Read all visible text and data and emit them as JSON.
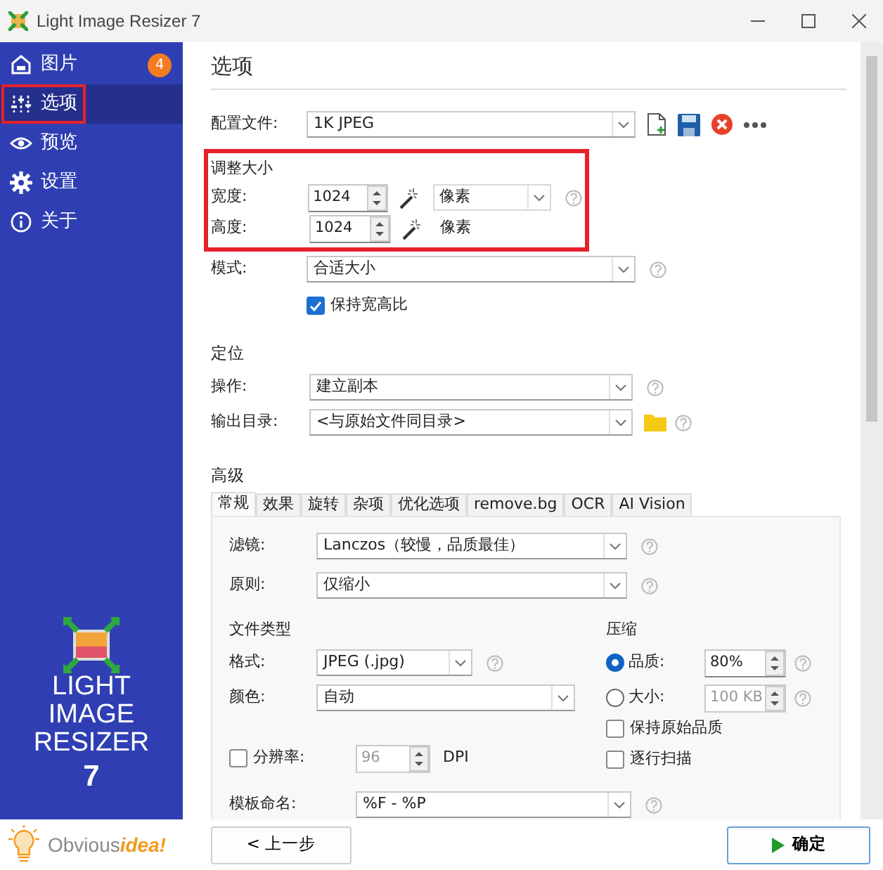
{
  "window": {
    "title": "Light Image Resizer 7"
  },
  "sidebar": {
    "items": [
      {
        "label": "图片",
        "badge": "4",
        "selected": false,
        "highlighted": false
      },
      {
        "label": "选项",
        "selected": true,
        "highlighted": true
      },
      {
        "label": "预览",
        "selected": false,
        "highlighted": false
      },
      {
        "label": "设置",
        "selected": false,
        "highlighted": false
      },
      {
        "label": "关于",
        "selected": false,
        "highlighted": false
      }
    ],
    "logo_lines": [
      "LIGHT",
      "IMAGE",
      "RESIZER",
      "7"
    ],
    "brand": {
      "name": "Obvious",
      "accent": "idea!"
    }
  },
  "page_title": "选项",
  "profile": {
    "label": "配置文件:",
    "value": "1K JPEG"
  },
  "resize": {
    "title": "调整大小",
    "highlighted": true,
    "width": {
      "label": "宽度:",
      "value": "1024",
      "unit": "像素",
      "kind": "dropdown"
    },
    "height": {
      "label": "高度:",
      "value": "1024",
      "unit": "像素",
      "kind": "text"
    }
  },
  "mode": {
    "label": "模式:",
    "value": "合适大小"
  },
  "keep_ratio": {
    "label": "保持宽高比",
    "checked": true
  },
  "destination": {
    "title": "定位",
    "operation": {
      "label": "操作:",
      "value": "建立副本"
    },
    "output": {
      "label": "输出目录:",
      "value": "<与原始文件同目录>"
    }
  },
  "advanced": {
    "title": "高级",
    "tabs": [
      {
        "label": "常规",
        "selected": true
      },
      {
        "label": "效果",
        "selected": false
      },
      {
        "label": "旋转",
        "selected": false
      },
      {
        "label": "杂项",
        "selected": false
      },
      {
        "label": "优化选项",
        "selected": false
      },
      {
        "label": "remove.bg",
        "selected": false
      },
      {
        "label": "OCR",
        "selected": false
      },
      {
        "label": "AI Vision",
        "selected": false
      }
    ],
    "filter": {
      "label": "滤镜:",
      "value": "Lanczos（较慢，品质最佳）"
    },
    "rule": {
      "label": "原则:",
      "value": "仅缩小"
    },
    "file_type": {
      "title": "文件类型",
      "format": {
        "label": "格式:",
        "value": "JPEG (.jpg)"
      },
      "color": {
        "label": "颜色:",
        "value": "自动"
      }
    },
    "resolution": {
      "label": "分辨率:",
      "checked": false,
      "value": "96",
      "unit": "DPI"
    },
    "compression": {
      "title": "压缩",
      "options": [
        {
          "label": "品质:",
          "selected": true,
          "value": "80%"
        },
        {
          "label": "大小:",
          "selected": false,
          "value": "100 KB"
        }
      ],
      "checks": [
        {
          "label": "保持原始品质",
          "checked": false
        },
        {
          "label": "逐行扫描",
          "checked": false
        }
      ]
    },
    "naming": {
      "label": "模板命名:",
      "value": "%F - %P"
    }
  },
  "footer": {
    "back": "< 上一步",
    "ok": "确定"
  }
}
